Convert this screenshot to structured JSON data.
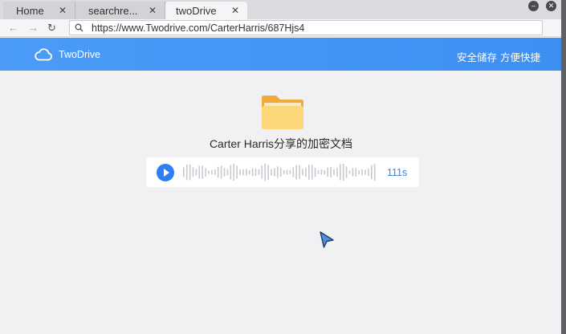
{
  "browser": {
    "tabs": [
      {
        "label": "Home",
        "active": false
      },
      {
        "label": "searchre...",
        "active": false
      },
      {
        "label": "twoDrive",
        "active": true
      }
    ],
    "close_glyph": "✕",
    "url": "https://www.Twodrive.com/CarterHarris/687Hjs4",
    "icons": {
      "back": "back-arrow-icon",
      "forward": "forward-arrow-icon",
      "reload": "reload-icon",
      "search": "search-icon",
      "minimize": "minimize-icon",
      "close": "close-icon"
    }
  },
  "header": {
    "brand": "TwoDrive",
    "taglines": [
      "安全储存",
      "方便快捷"
    ],
    "logo_icon": "cloud-icon",
    "color": "#4596f5"
  },
  "main": {
    "folder_icon": "folder-icon",
    "file_title": "Carter Harris分享的加密文档",
    "voice": {
      "duration": "111s",
      "play_icon": "play-icon",
      "accent": "#2d7ff3"
    }
  }
}
